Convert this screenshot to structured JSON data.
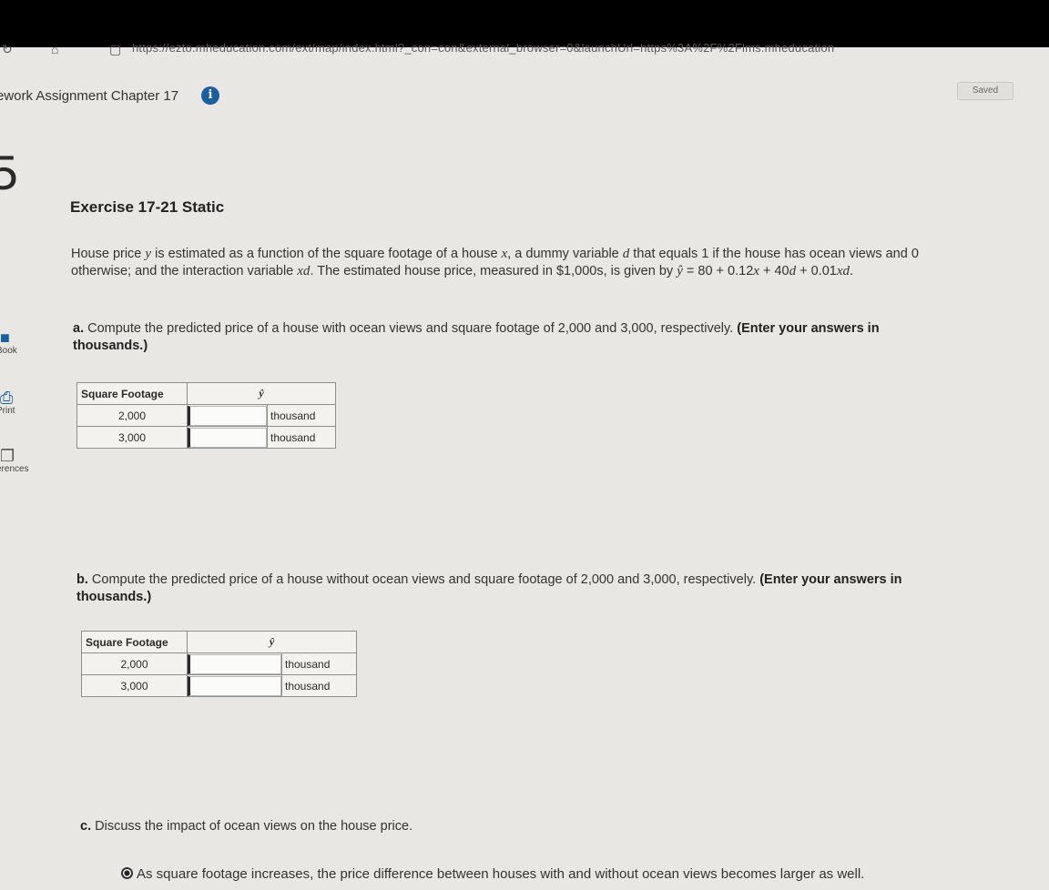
{
  "browser": {
    "url_text": "https://ezto.mheducation.com/ext/map/index.html?_con=con&external_browser=0&launchUrl=https%3A%2F%2Flms.mheducation"
  },
  "header": {
    "assignment_title": "ework Assignment Chapter 17",
    "info_icon": "i",
    "saved_label": "Saved"
  },
  "question_number": "5",
  "sidebar": {
    "items": [
      {
        "label": "Book",
        "icon": "book-icon"
      },
      {
        "label": "Print",
        "icon": "print-icon"
      },
      {
        "label": "erences",
        "icon": "references-icon"
      }
    ]
  },
  "exercise": {
    "title": "Exercise 17-21 Static",
    "intro": {
      "t1": "House price ",
      "y": "y",
      "t2": " is estimated as a function of the square footage of a house ",
      "x": "x",
      "t3": ", a dummy variable ",
      "d": "d",
      "t4": " that equals 1 if the house has ocean views and 0 otherwise; and the interaction variable ",
      "xd": "xd",
      "t5": ". The estimated house price, measured in $1,000s, is given by ",
      "yhat": "ŷ",
      "t6": " = 80 + 0.12",
      "x2": "x",
      "t7": " + 40",
      "d2": "d",
      "t8": " + 0.01",
      "xd2": "xd",
      "t9": "."
    },
    "part_a": {
      "lead": "a.",
      "text": " Compute the predicted price of a house with ocean views and square footage of 2,000 and 3,000, respectively. ",
      "bold": "(Enter your answers in thousands.)"
    },
    "part_b": {
      "lead": "b.",
      "text": " Compute the predicted price of a house without ocean views and square footage of 2,000 and 3,000, respectively. ",
      "bold": "(Enter your answers in thousands.)"
    },
    "table_header": {
      "col1": "Square Footage",
      "col2": "ŷ"
    },
    "table_a": [
      {
        "sqft": "2,000",
        "value": "",
        "unit": "thousand"
      },
      {
        "sqft": "3,000",
        "value": "",
        "unit": "thousand"
      }
    ],
    "table_b": [
      {
        "sqft": "2,000",
        "value": "",
        "unit": "thousand"
      },
      {
        "sqft": "3,000",
        "value": "",
        "unit": "thousand"
      }
    ],
    "part_c": {
      "lead": "c.",
      "text": " Discuss the impact of ocean views on the house price."
    },
    "option_1": "As square footage increases, the price difference between houses with and without ocean views becomes larger as well."
  }
}
